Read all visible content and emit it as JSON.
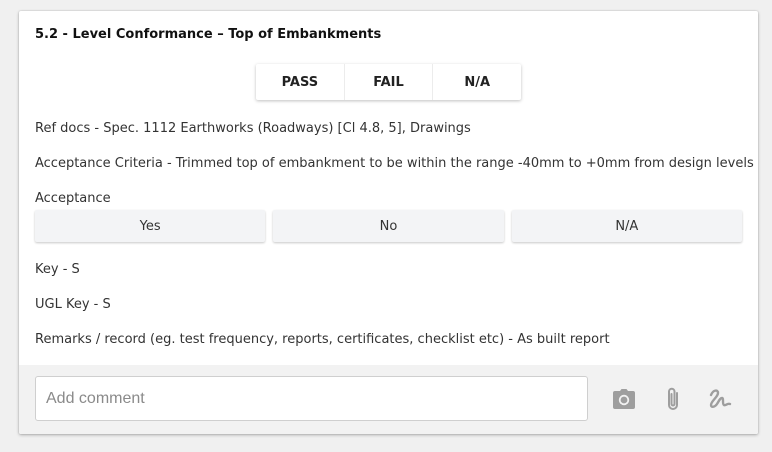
{
  "section": {
    "title": "5.2 - Level Conformance – Top of Embankments"
  },
  "result_options": {
    "pass": "PASS",
    "fail": "FAIL",
    "na": "N/A"
  },
  "details": {
    "ref_docs": "Ref docs - Spec. 1112 Earthworks (Roadways) [Cl 4.8, 5], Drawings",
    "acceptance_criteria": "Acceptance Criteria - Trimmed top of embankment to be within the range -40mm to +0mm from design levels",
    "acceptance_label": "Acceptance",
    "key": "Key - S",
    "ugl_key": "UGL Key - S",
    "remarks": "Remarks / record (eg. test frequency, reports, certificates, checklist etc) - As built report"
  },
  "acceptance_options": {
    "yes": "Yes",
    "no": "No",
    "na": "N/A"
  },
  "comment": {
    "placeholder": "Add comment",
    "value": ""
  },
  "footer_icons": [
    "camera-icon",
    "paperclip-icon",
    "signature-icon"
  ],
  "colors": {
    "icon": "#9e9e9e",
    "footer_bg": "#f2f2f2",
    "button_bg": "#f3f4f6"
  }
}
